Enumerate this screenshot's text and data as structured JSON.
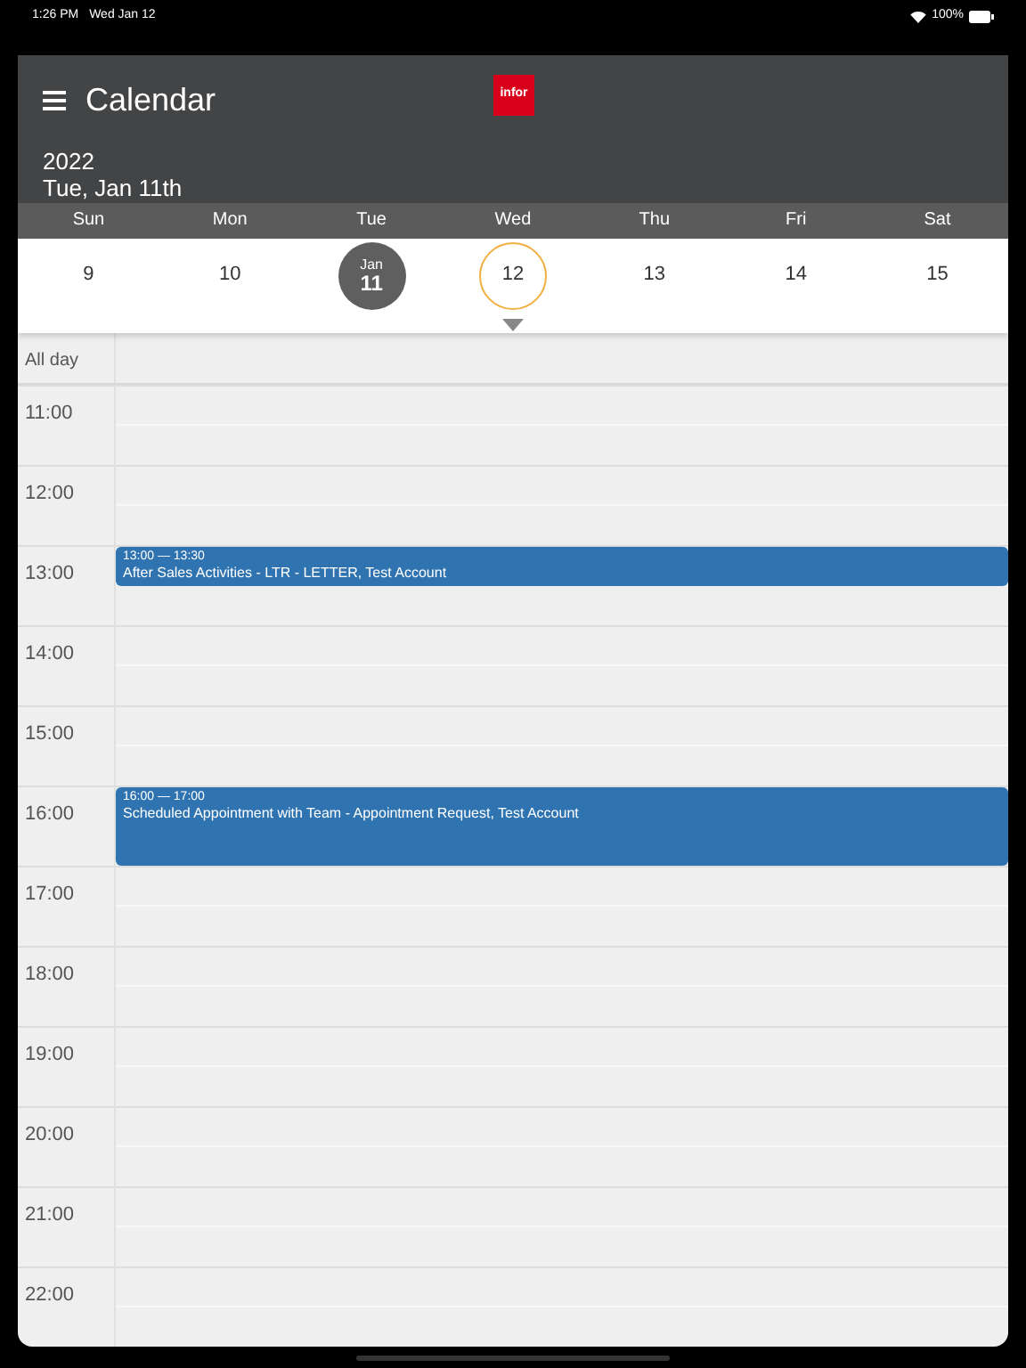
{
  "status_bar": {
    "time": "1:26 PM",
    "date": "Wed Jan 12",
    "battery": "100%"
  },
  "header": {
    "title": "Calendar",
    "logo": "infor",
    "year": "2022",
    "selected_date": "Tue, Jan 11th"
  },
  "week": [
    {
      "weekday": "Sun",
      "day": "9",
      "selected": false,
      "today": false
    },
    {
      "weekday": "Mon",
      "day": "10",
      "selected": false,
      "today": false
    },
    {
      "weekday": "Tue",
      "day": "11",
      "month": "Jan",
      "selected": true,
      "today": false
    },
    {
      "weekday": "Wed",
      "day": "12",
      "selected": false,
      "today": true
    },
    {
      "weekday": "Thu",
      "day": "13",
      "selected": false,
      "today": false
    },
    {
      "weekday": "Fri",
      "day": "14",
      "selected": false,
      "today": false
    },
    {
      "weekday": "Sat",
      "day": "15",
      "selected": false,
      "today": false
    }
  ],
  "all_day_label": "All day",
  "hours": [
    "11:00",
    "12:00",
    "13:00",
    "14:00",
    "15:00",
    "16:00",
    "17:00",
    "18:00",
    "19:00",
    "20:00",
    "21:00",
    "22:00"
  ],
  "events": [
    {
      "time": "13:00 — 13:30",
      "title": "After Sales Activities - LTR - LETTER, Test Account"
    },
    {
      "time": "16:00 — 17:00",
      "title": "Scheduled Appointment with Team - Appointment Request, Test Account"
    }
  ]
}
